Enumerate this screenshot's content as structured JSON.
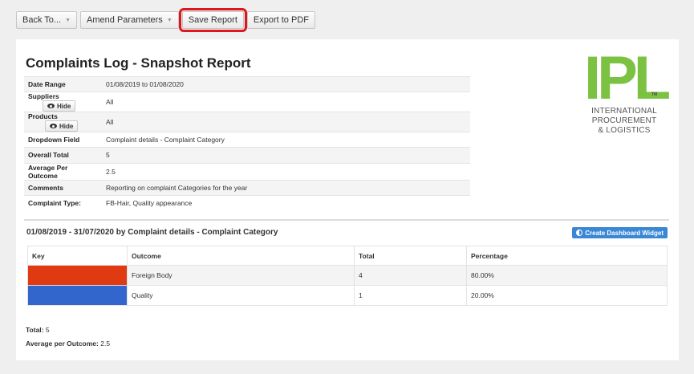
{
  "toolbar": {
    "back_label": "Back To...",
    "amend_label": "Amend Parameters",
    "save_label": "Save Report",
    "export_label": "Export to PDF"
  },
  "report": {
    "title": "Complaints Log - Snapshot Report",
    "fields": [
      {
        "key": "Date Range",
        "value": "01/08/2019 to 01/08/2020"
      },
      {
        "key": "Suppliers",
        "value": "All",
        "button": "Hide"
      },
      {
        "key": "Products",
        "value": "All",
        "button": "Hide"
      },
      {
        "key": "Dropdown Field",
        "value": "Complaint details - Complaint Category"
      },
      {
        "key": "Overall Total",
        "value": "5"
      },
      {
        "key": "Average Per Outcome",
        "value": "2.5"
      },
      {
        "key": "Comments",
        "value": "Reporting on complaint Categories for the year"
      },
      {
        "key": "Complaint Type:",
        "value": "FB-Hair, Quality appearance"
      }
    ]
  },
  "logo": {
    "letters": "IPL",
    "tm": "TM",
    "line1": "INTERNATIONAL",
    "line2": "PROCUREMENT",
    "line3": "& LOGISTICS",
    "color": "#7cc242"
  },
  "section": {
    "title": "01/08/2019 - 31/07/2020 by Complaint details - Complaint Category",
    "widget_button": "Create Dashboard Widget"
  },
  "outcomes": {
    "headers": [
      "Key",
      "Outcome",
      "Total",
      "Percentage"
    ],
    "rows": [
      {
        "color": "#df3a12",
        "outcome": "Foreign Body",
        "total": "4",
        "percentage": "80.00%"
      },
      {
        "color": "#3366cc",
        "outcome": "Quality",
        "total": "1",
        "percentage": "20.00%"
      }
    ]
  },
  "summary": {
    "total_label": "Total:",
    "total_value": "5",
    "avg_label": "Average per Outcome:",
    "avg_value": "2.5"
  }
}
